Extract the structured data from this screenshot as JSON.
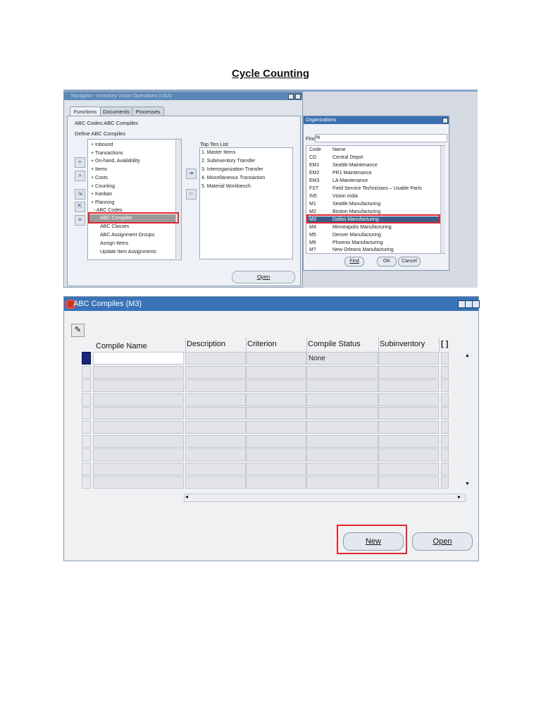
{
  "doc_title": "Cycle Counting",
  "navigator": {
    "window_title": "Navigator - Inventory Vision Operations (USA)",
    "tabs": [
      "Functions",
      "Documents",
      "Processes"
    ],
    "breadcrumb": "ABC Codes:ABC Compiles",
    "subtitle": "Define ABC Compiles",
    "functions": [
      {
        "label": "+  Inbound"
      },
      {
        "label": "+  Transactions"
      },
      {
        "label": "+  On-hand, Availability"
      },
      {
        "label": "+  Items"
      },
      {
        "label": "+  Costs"
      },
      {
        "label": "+  Counting"
      },
      {
        "label": "+  Kanban"
      },
      {
        "label": "+  Planning"
      },
      {
        "label": "- ABC Codes"
      },
      {
        "label": "ABC Compiles",
        "selected": true
      },
      {
        "label": "ABC Classes"
      },
      {
        "label": "ABC Assignment Groups"
      },
      {
        "label": "Assign Items"
      },
      {
        "label": "Update Item Assignments"
      }
    ],
    "top_ten_title": "Top Ten List",
    "top_ten": [
      "1. Master Items",
      "2. Subinventory Transfer",
      "3. Interorganization Transfer",
      "4. Miscellaneous Transaction",
      "5. Material Workbench"
    ],
    "open_button": "Open",
    "icons": [
      "add-icon",
      "expand-icon",
      "expand-all-icon",
      "collapse-all-icon",
      "remove-icon",
      "arrow-right-icon",
      "arrow-left-icon"
    ]
  },
  "organizations": {
    "title": "Organizations",
    "find_label": "Find",
    "find_value": "%",
    "headers": [
      "Code",
      "Name"
    ],
    "rows": [
      {
        "code": "CD",
        "name": "Central Depot"
      },
      {
        "code": "EM1",
        "name": "Seattle Maintenance"
      },
      {
        "code": "EM2",
        "name": "PR1 Maintenance"
      },
      {
        "code": "EM3",
        "name": "LA Maintenance"
      },
      {
        "code": "FST",
        "name": "Field Service Technicians – Usable Parts"
      },
      {
        "code": "IN5",
        "name": "Vision India"
      },
      {
        "code": "M1",
        "name": "Seattle Manufacturing"
      },
      {
        "code": "M2",
        "name": "Boston Manufacturing"
      },
      {
        "code": "M3",
        "name": "Dallas Manufacturing",
        "selected": true
      },
      {
        "code": "M4",
        "name": "Minneapolis Manufacturing"
      },
      {
        "code": "M5",
        "name": "Denver Manufacturing"
      },
      {
        "code": "M6",
        "name": "Phoenix Manufacturing"
      },
      {
        "code": "M7",
        "name": "New Orleans Manufacturing"
      }
    ],
    "buttons": {
      "find": "Find",
      "ok": "OK",
      "cancel": "Cancel"
    }
  },
  "abc": {
    "title": "ABC Compiles (M3)",
    "columns": [
      "Compile Name",
      "Description",
      "Criterion",
      "Compile Status",
      "Subinventory",
      "[ ]"
    ],
    "first_row_status": "None",
    "row_count": 10,
    "new_button": "New",
    "open_button": "Open"
  },
  "colors": {
    "highlight": "#e0262d",
    "titlebar": "#3a73b8",
    "selection": "#3d5c8a",
    "current_row": "#1a237e"
  }
}
